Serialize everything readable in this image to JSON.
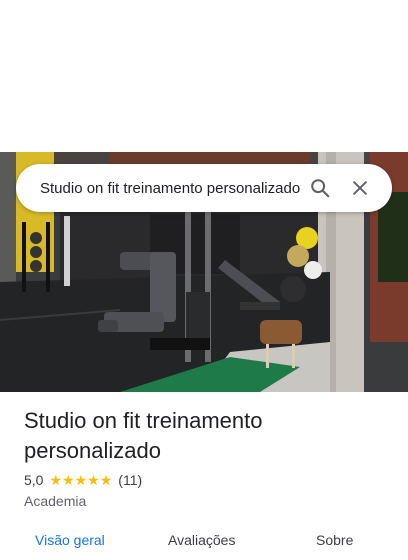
{
  "search": {
    "query": "Studio on fit treinamento personalizado"
  },
  "icons": {
    "search": "search-icon",
    "close": "close-icon",
    "star": "star-icon"
  },
  "place": {
    "name": "Studio on fit treinamento personalizado",
    "rating": "5,0",
    "stars": 5,
    "review_count": "(11)",
    "category": "Academia"
  },
  "tabs": [
    {
      "label": "Visão geral",
      "active": true
    },
    {
      "label": "Avaliações",
      "active": false
    },
    {
      "label": "Sobre",
      "active": false
    }
  ],
  "colors": {
    "accent": "#1a73e8",
    "star": "#fbbc04"
  }
}
